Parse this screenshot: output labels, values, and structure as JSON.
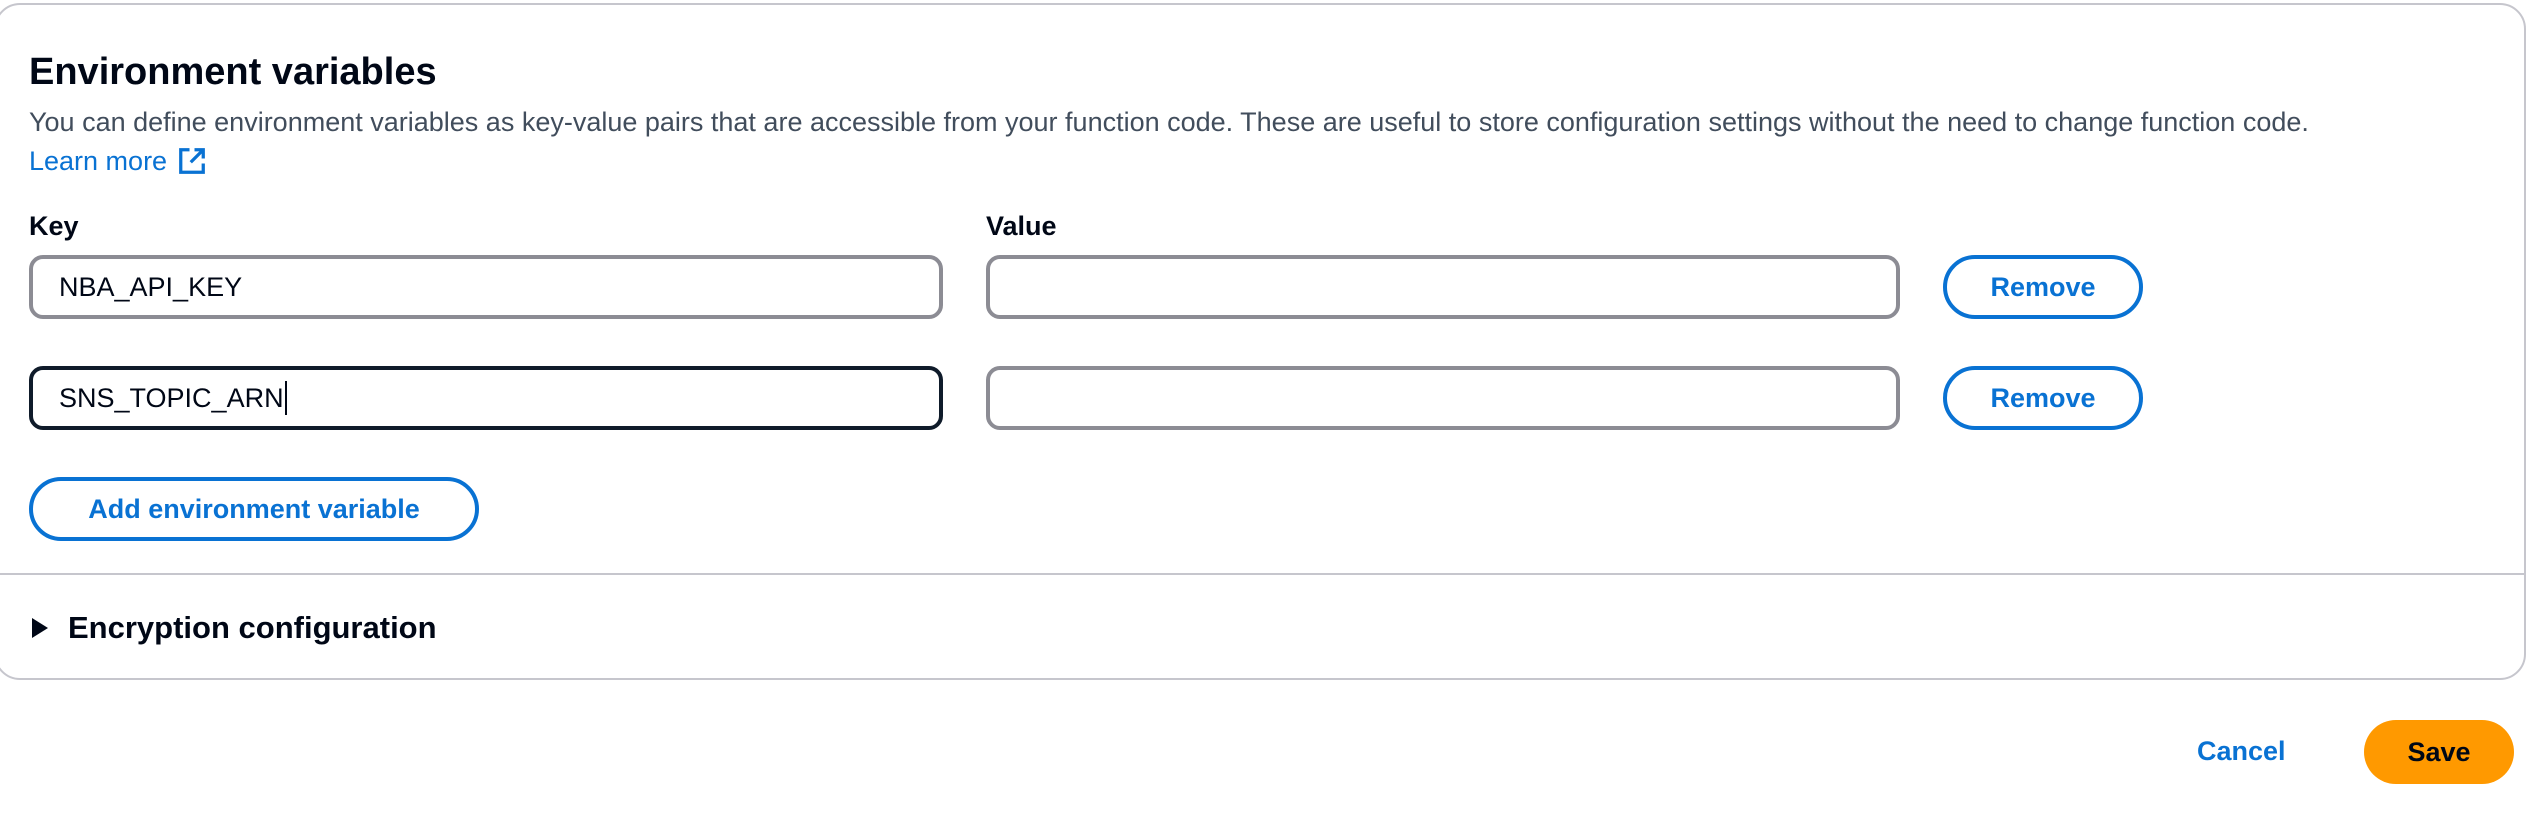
{
  "section": {
    "title": "Environment variables",
    "description": "You can define environment variables as key-value pairs that are accessible from your function code. These are useful to store configuration settings without the need to change function code.",
    "learn_more": "Learn more"
  },
  "columns": {
    "key_label": "Key",
    "value_label": "Value"
  },
  "rows": [
    {
      "key": "NBA_API_KEY",
      "value": "",
      "remove_label": "Remove"
    },
    {
      "key": "SNS_TOPIC_ARN",
      "value": "",
      "remove_label": "Remove"
    }
  ],
  "add_button_label": "Add environment variable",
  "encryption": {
    "label": "Encryption configuration",
    "expanded": false
  },
  "footer": {
    "cancel_label": "Cancel",
    "save_label": "Save"
  },
  "colors": {
    "link": "#0972d3",
    "primary_button": "#ff9900",
    "border": "#c6c6cd",
    "text": "#000716"
  },
  "icons": {
    "learn_more": "external-link-icon",
    "expander": "caret-right-icon"
  }
}
